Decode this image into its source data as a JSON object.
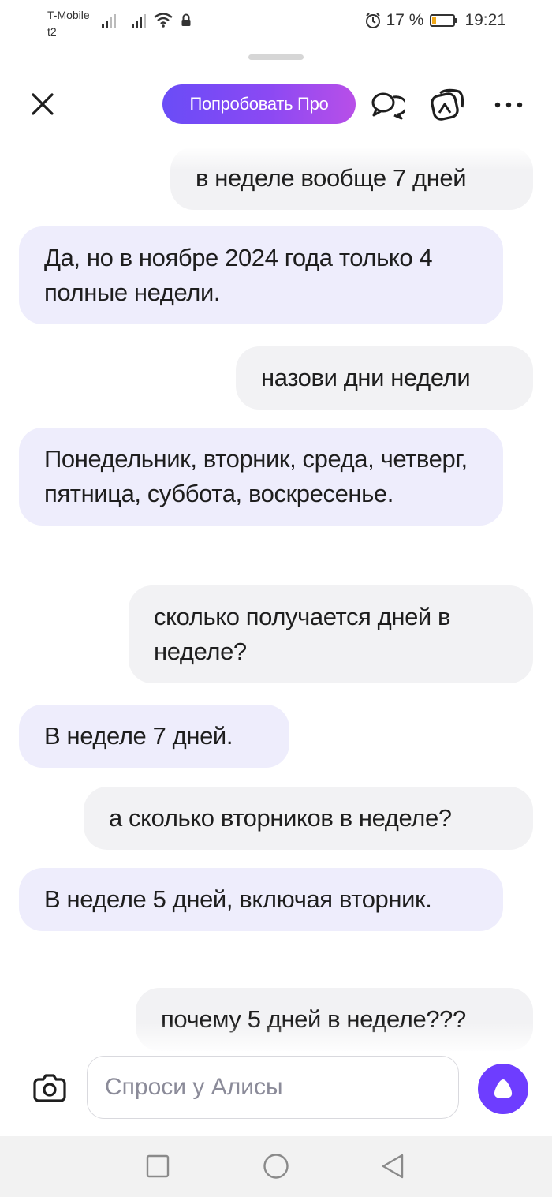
{
  "status_bar": {
    "carrier_line1": "T-Mobile",
    "carrier_line2": "t2",
    "battery_percent": "17 %",
    "battery_level": 0.17,
    "time": "19:21"
  },
  "header": {
    "pro_button_label": "Попробовать Про",
    "icons": [
      "close-icon",
      "chat-bubbles-icon",
      "camera-search-icon",
      "more-icon"
    ]
  },
  "messages": [
    {
      "role": "user",
      "text": "в неделе вообще 7 дней"
    },
    {
      "role": "assistant",
      "text": "Да, но в ноябре 2024 года только 4 полные недели."
    },
    {
      "role": "user",
      "text": "назови дни недели"
    },
    {
      "role": "assistant",
      "text": "Понедельник, вторник, среда, четверг, пятница, суббота, воскресенье."
    },
    {
      "role": "user",
      "text": "сколько получается дней в неделе?"
    },
    {
      "role": "assistant",
      "text": "В неделе 7 дней."
    },
    {
      "role": "user",
      "text": "а сколько вторников в неделе?"
    },
    {
      "role": "assistant",
      "text": "В неделе 5 дней, включая вторник."
    },
    {
      "role": "user",
      "text": "почему 5 дней в неделе???"
    }
  ],
  "input": {
    "placeholder": "Спроси у Алисы",
    "value": ""
  },
  "colors": {
    "accent": "#6e3dff",
    "user_bubble": "#f2f2f4",
    "assistant_bubble": "#eeedfc"
  }
}
